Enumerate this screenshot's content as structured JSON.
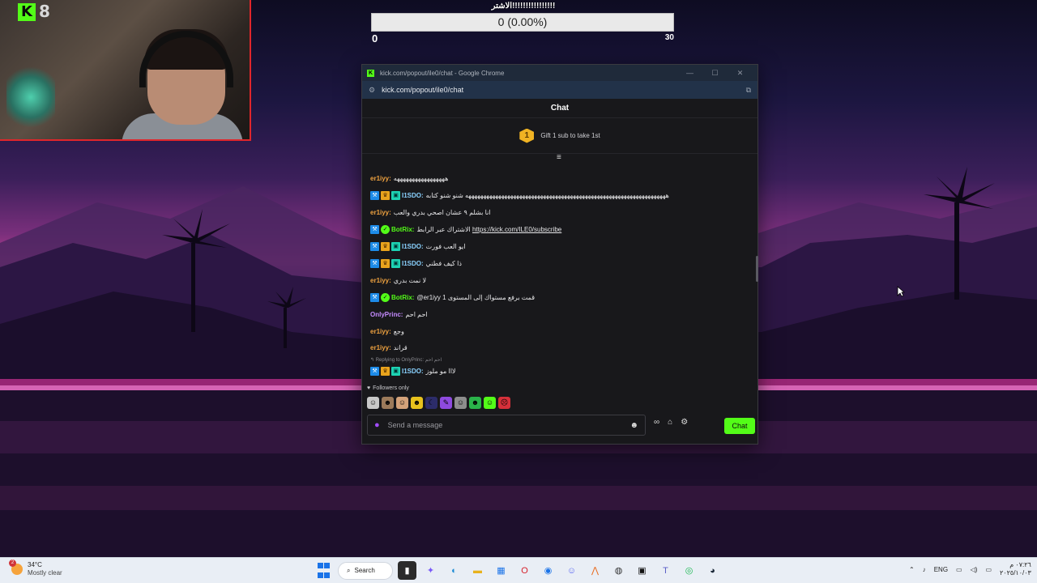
{
  "webcam": {
    "viewer_count": "8"
  },
  "poll": {
    "title": "الاشتر!!!!!!!!!!!!!!!!",
    "bar_text": "0 (0.00%)",
    "progress": 0,
    "min_label": "0",
    "max_label": "30"
  },
  "window": {
    "title": "kick.com/popout/ile0/chat - Google Chrome",
    "url": "kick.com/popout/ile0/chat",
    "minimize": "—",
    "maximize": "☐",
    "close": "✕"
  },
  "chat": {
    "header": "Chat",
    "gift_badge": "1",
    "gift_text": "Gift 1 sub to take 1st",
    "messages": [
      {
        "user": "er1iyy:",
        "text": "هههههههههههههههههه"
      },
      {
        "user": "I1SDO:",
        "text": "هههههههههههههههههههههههههههههههههههههههههههههههههههههههههههههههههههه شنو شنو كتابه"
      },
      {
        "user": "er1iyy:",
        "text": "انا بشلم ٩ عشان اصحي بدري والعب"
      },
      {
        "user": "BotRix:",
        "text": "الاشتراك عبر الرابط",
        "link": "https://kick.com/ILE0/subscribe"
      },
      {
        "user": "I1SDO:",
        "text": "ايو العب فورت"
      },
      {
        "user": "I1SDO:",
        "text": "ذا كيف فطني"
      },
      {
        "user": "er1iyy:",
        "text": "لا نمت بدري"
      },
      {
        "user": "BotRix:",
        "text": "@er1iyy 1 قمت برفع مستواك إلى المستوى"
      },
      {
        "user": "OnlyPrinc:",
        "text": "احم احم"
      },
      {
        "user": "er1iyy:",
        "text": "وجع"
      },
      {
        "user": "er1iyy:",
        "text": "قراند"
      },
      {
        "user": "I1SDO:",
        "text": "لااا مو ملوز"
      }
    ],
    "reply_hint": "↰ Replying to OnlyPrinc: احم احم",
    "followers_only": "Followers only",
    "composer_placeholder": "Send a message",
    "send_label": "Chat"
  },
  "taskbar": {
    "weather_temp": "34°C",
    "weather_cond": "Mostly clear",
    "weather_alert": "2",
    "search_label": "Search",
    "language": "ENG",
    "time": "٠٧:٢٦ م",
    "date": "٢٠٢٥/١٠/٠٣"
  },
  "colors": {
    "kick_green": "#53fc18",
    "user_orange": "#f0a340",
    "user_lightblue": "#8ad2ff",
    "user_green": "#53fc18",
    "user_purple": "#c58bff"
  }
}
